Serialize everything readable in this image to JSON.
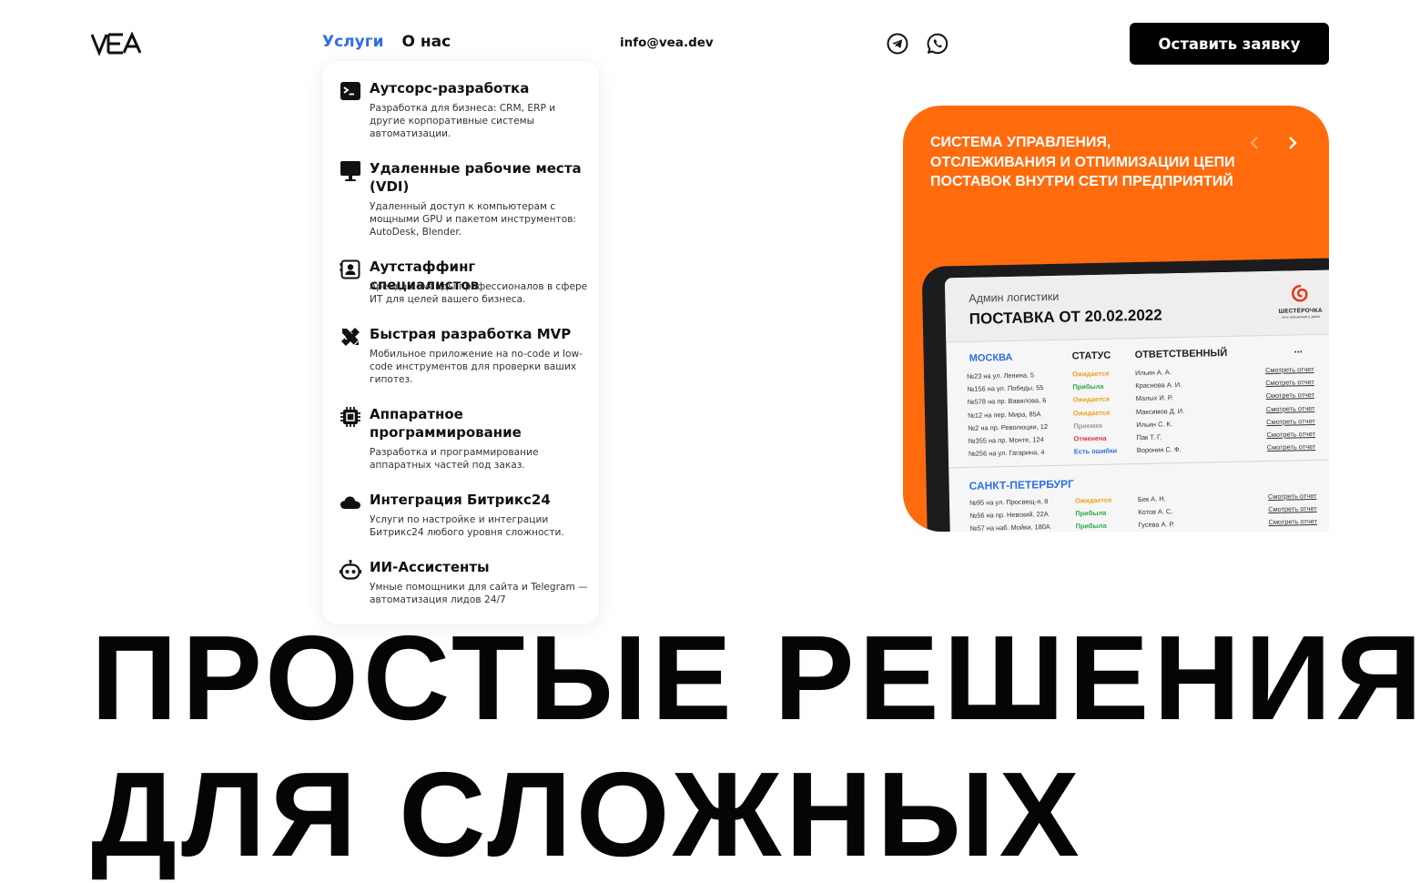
{
  "header": {
    "logo_text": "VEA",
    "nav": {
      "services": "Услуги",
      "about": "О нас"
    },
    "email": "info@vea.dev",
    "social": [
      {
        "icon": "telegram-icon"
      },
      {
        "icon": "whatsapp-icon"
      }
    ],
    "cta_label": "Оставить заявку"
  },
  "services_menu": [
    {
      "icon": "terminal-icon",
      "title": "Аутсорс-разработка",
      "desc": "Разработка для бизнеса: CRM, ERP и другие корпоративные системы автоматизации."
    },
    {
      "icon": "monitor-icon",
      "title": "Удаленные рабочие места (VDI)",
      "desc": "Удаленный доступ к компьютерам с мощными GPU и пакетом инструментов: AutoDesk, Blender."
    },
    {
      "icon": "contact-card-icon",
      "title": "Аутстаффинг специалистов",
      "desc": "Аренда команды профессионалов в сфере ИТ для целей вашего бизнеса."
    },
    {
      "icon": "ruler-pencil-icon",
      "title": "Быстрая разработка MVP",
      "desc": "Мобильное приложение на no-code и low-code инструментов для проверки ваших гипотез."
    },
    {
      "icon": "chip-icon",
      "title": "Аппаратное программирование",
      "desc": "Разработка и программирование аппаратных частей под заказ."
    },
    {
      "icon": "cloud-icon",
      "title": "Интеграция Битрикс24",
      "desc": "Услуги по настройке и интеграции Битрикс24 любого уровня сложности."
    },
    {
      "icon": "robot-icon",
      "title": "ИИ-Ассистенты",
      "desc": "Умные помощники для сайта и Telegram — автоматизация лидов 24/7"
    }
  ],
  "hero_card": {
    "caption": "Система управления, отслеживания и отпимизации цепи поставок внутри сети предприятий",
    "accent_color": "#ff6b0d",
    "screen": {
      "label": "Админ логистики",
      "title": "ПОСТАВКА ОТ 20.02.2022",
      "brand_name": "ШЕСТЁРОЧКА",
      "brand_tagline": "сеть магазинов у дома",
      "columns": {
        "status": "СТАТУС",
        "responsible": "ОТВЕТСТВЕННЫЙ",
        "more": "..."
      },
      "sections": [
        {
          "city": "МОСКВА",
          "rows": [
            {
              "address": "№23 на ул. Ленина, 5",
              "status": "Ожидается",
              "status_color": "#f0a020",
              "person": "Ильин А. А.",
              "link": "Смотреть отчет"
            },
            {
              "address": "№156 на ул. Победы, 55",
              "status": "Прибыла",
              "status_color": "#2aa84a",
              "person": "Краснова А. И.",
              "link": "Смотреть отчет"
            },
            {
              "address": "№578 на пр. Вавилова, 6",
              "status": "Ожидается",
              "status_color": "#f0a020",
              "person": "Малых И. Р.",
              "link": "Смотреть отчет"
            },
            {
              "address": "№12 на пер. Мира, 85А",
              "status": "Ожидается",
              "status_color": "#f0a020",
              "person": "Максимов Д. И.",
              "link": "Смотреть отчет"
            },
            {
              "address": "№2 на пр. Революции, 12",
              "status": "Приемка",
              "status_color": "#9a9a9a",
              "person": "Ильин С. К.",
              "link": "Смотреть отчет"
            },
            {
              "address": "№355 на пр. Монте, 124",
              "status": "Отменена",
              "status_color": "#e0303a",
              "person": "Пак Т. Г.",
              "link": "Смотреть отчет"
            },
            {
              "address": "№256 на ул. Гагарина, 4",
              "status": "Есть ошибки",
              "status_color": "#2f6fe0",
              "person": "Воронин С. Ф.",
              "link": "Смотреть отчет"
            }
          ]
        },
        {
          "city": "САНКТ-ПЕТЕРБУРГ",
          "rows": [
            {
              "address": "№95 на ул. Просвещ-я, 8",
              "status": "Ожидается",
              "status_color": "#f0a020",
              "person": "Бек А. Н.",
              "link": "Смотреть отчет"
            },
            {
              "address": "№56 на пр. Невский, 22А",
              "status": "Прибыла",
              "status_color": "#2aa84a",
              "person": "Котов А. С.",
              "link": "Смотреть отчет"
            },
            {
              "address": "№57 на наб. Мойки, 180А",
              "status": "Прибыла",
              "status_color": "#2aa84a",
              "person": "Гусева А. Р.",
              "link": "Смотреть отчет"
            }
          ]
        }
      ]
    }
  },
  "headline": {
    "line1": "ПРОСТЫЕ РЕШЕНИЯ",
    "line2": "ДЛЯ СЛОЖНЫХ"
  }
}
